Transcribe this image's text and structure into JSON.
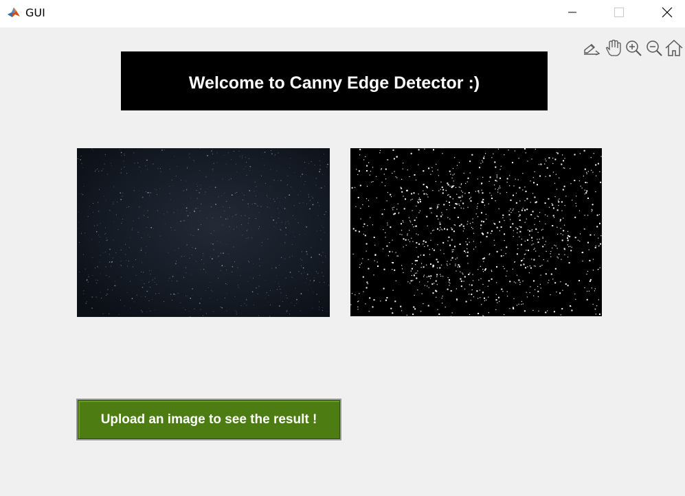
{
  "window": {
    "title": "GUI",
    "icon": "matlab-icon",
    "controls": [
      "minimize-icon",
      "maximize-icon",
      "close-icon"
    ]
  },
  "toolbar": {
    "tools": [
      "brush-icon",
      "pan-hand-icon",
      "zoom-in-icon",
      "zoom-out-icon",
      "home-icon"
    ]
  },
  "banner": {
    "text": "Welcome to Canny Edge Detector :)"
  },
  "axes": {
    "original_image": "starfield-photo",
    "edge_image": "canny-edge-output"
  },
  "upload": {
    "label": "Upload an image to see the result !"
  },
  "colors": {
    "background": "#f0f0f0",
    "banner_bg": "#000000",
    "banner_text": "#ffffff",
    "button_bg": "#4d7c12",
    "button_text": "#ffffff"
  }
}
